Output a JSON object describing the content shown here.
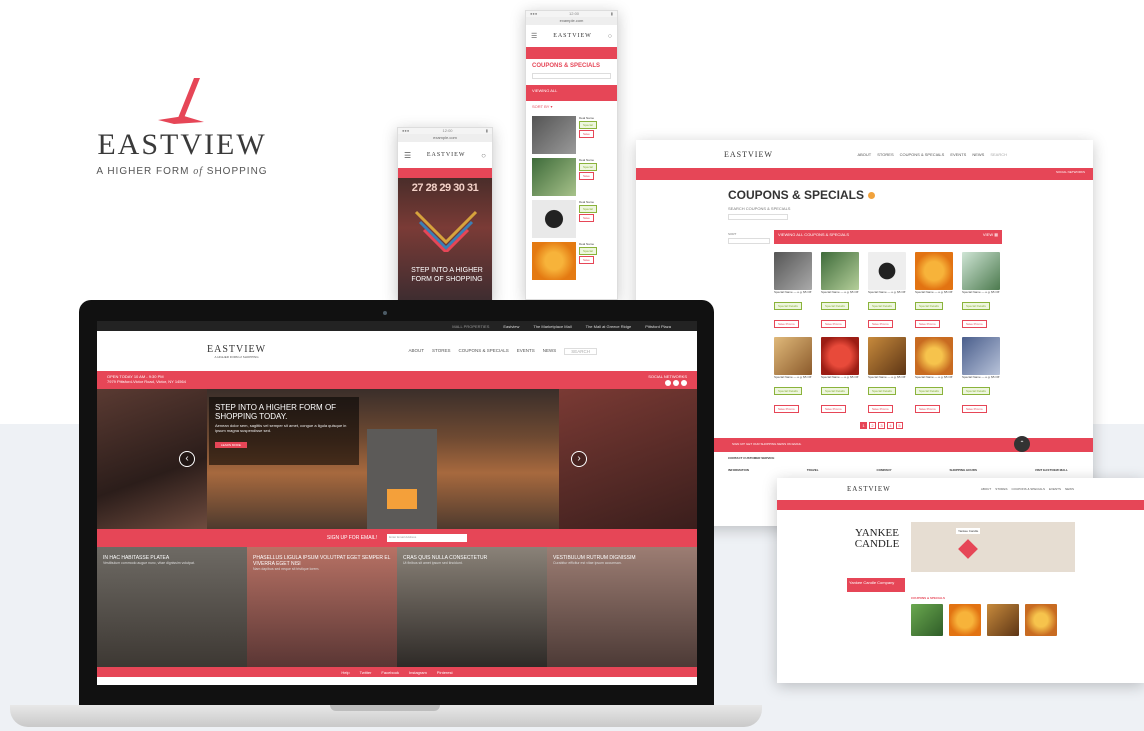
{
  "brand": {
    "name": "EASTVIEW",
    "tagline_a": "A HIGHER FORM",
    "tagline_of": "of",
    "tagline_b": "SHOPPING",
    "red": "#e64657"
  },
  "phone_small": {
    "logo": "EASTVIEW",
    "numbers": "27 28 29 30 31",
    "hero_text": "STEP INTO A HIGHER FORM OF SHOPPING"
  },
  "phone_tall": {
    "logo": "EASTVIEW",
    "title": "COUPONS & SPECIALS",
    "bar": "VIEWING ALL",
    "sort": "SORT BY"
  },
  "desktop": {
    "logo": "EASTVIEW",
    "nav": [
      "ABOUT",
      "STORES",
      "COUPONS & SPECIALS",
      "EVENTS",
      "NEWS"
    ],
    "search": "SEARCH",
    "social": "SOCIAL NETWORKS",
    "title": "COUPONS & SPECIALS",
    "search_label": "SEARCH COUPONS & SPECIALS",
    "sort_label": "SORT",
    "viewing": "VIEWING ALL COUPONS & SPECIALS",
    "grid_label": "VIEW",
    "item_title": "Special Name — e.g. $5 Off",
    "item_desc": "when you buy at our Cloud Cafe",
    "btn_a": "Special Details",
    "btn_b": "Save Promo",
    "pages": [
      "1",
      "2",
      "3",
      "4",
      "5"
    ],
    "promo": "SIGN UP! GET OUR SHOPPING NEWS ON EMAIL",
    "contact": "CONTACT CUSTOMER SERVICE",
    "footer_cols": [
      "INFORMATION",
      "TRAVEL",
      "COMPANY",
      "SHOPPING HOURS",
      "VISIT EASTVIEW MALL"
    ]
  },
  "store_page": {
    "logo": "EASTVIEW",
    "nav": [
      "ABOUT",
      "STORES",
      "COUPONS & SPECIALS",
      "EVENTS",
      "NEWS"
    ],
    "store_logo_a": "YANKEE",
    "store_logo_b": "CANDLE",
    "store_name": "Yankee Candle Company",
    "map_label": "Yankee Candle",
    "specials": "COUPONS & SPECIALS"
  },
  "laptop": {
    "mall_properties": "MALL PROPERTIES",
    "properties": [
      "Eastview",
      "The Marketplace Mall",
      "The Mall at Greece Ridge",
      "Pittsford Plaza"
    ],
    "logo": "EASTVIEW",
    "logo_tag": "A HIGHER FORM of SHOPPING",
    "nav": [
      "ABOUT",
      "STORES",
      "COUPONS & SPECIALS",
      "EVENTS",
      "NEWS"
    ],
    "search": "SEARCH",
    "hours": "OPEN TODAY 10 AM - 9:30 PM",
    "address": "7979 Pittsford-Victor Road, Victor, NY 14564",
    "social": "SOCIAL NETWORKS",
    "hero_title": "STEP INTO A HIGHER FORM OF SHOPPING TODAY.",
    "hero_body": "Aenean dolor sem, sagittis vel semper sit amet, congue a ligula quisque in ipsum magna suspendisse sed.",
    "hero_btn": "LEARN MORE",
    "signup": "SIGN UP FOR EMAIL!",
    "signup_placeholder": "Enter Email Address",
    "tiles": [
      {
        "title": "IN HAC HABITASSE PLATEA",
        "body": "Vestibulum commodo augue nunc, vitae dignissim volutpat."
      },
      {
        "title": "PHASELLUS LIGULA IPSUM VOLUTPAT EGET SEMPER EL VIVERRA EGET NISI",
        "body": "Nam dapibus sed neque sit tristique lorem."
      },
      {
        "title": "CRAS QUIS NULLA CONSECTETUR",
        "body": "Ut finibus sit amet ipsum sed tincidunt."
      },
      {
        "title": "VESTIBULUM RUTRUM DIGNISSIM",
        "body": "Curabitur efficitur est vitae ipsum accumsan."
      }
    ],
    "footer_links": [
      "Help",
      "Twitter",
      "Facebook",
      "Instagram",
      "Pinterest"
    ]
  }
}
